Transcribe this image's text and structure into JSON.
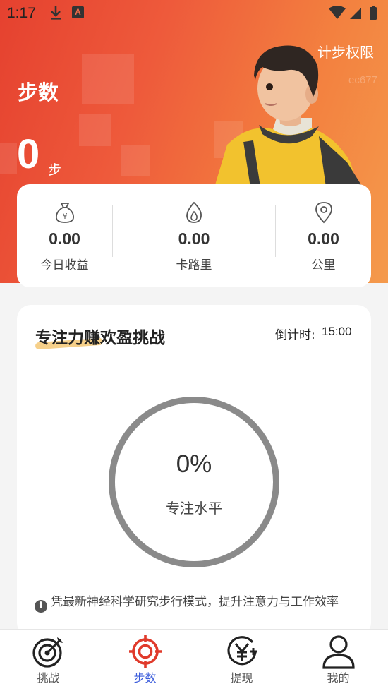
{
  "status_bar": {
    "time": "1:17",
    "app_badge": "A"
  },
  "header": {
    "permission_link": "计步权限",
    "faint_text": "ec677",
    "title": "步数",
    "step_count": "0",
    "step_unit": "步"
  },
  "stats": [
    {
      "icon": "money-bag-icon",
      "value": "0.00",
      "label": "今日收益"
    },
    {
      "icon": "flame-icon",
      "value": "0.00",
      "label": "卡路里"
    },
    {
      "icon": "location-pin-icon",
      "value": "0.00",
      "label": "公里"
    }
  ],
  "challenge": {
    "title": "专注力赚欢盈挑战",
    "countdown_label": "倒计时:",
    "countdown_value": "15:00",
    "percent": "0%",
    "percent_label": "专注水平",
    "description": "凭最新神经科学研究步行模式，提升注意力与工作效率"
  },
  "tabs": [
    {
      "label": "挑战",
      "icon": "target-arrow-icon",
      "active": false
    },
    {
      "label": "步数",
      "icon": "crosshair-icon",
      "active": true
    },
    {
      "label": "提现",
      "icon": "yen-coin-icon",
      "active": false
    },
    {
      "label": "我的",
      "icon": "person-icon",
      "active": false
    }
  ],
  "colors": {
    "hero_start": "#e5412f",
    "hero_end": "#f49a4c",
    "active_tab_icon": "#e03a2b",
    "active_tab_text": "#3a5bdb",
    "ring": "#8a8a8a"
  }
}
